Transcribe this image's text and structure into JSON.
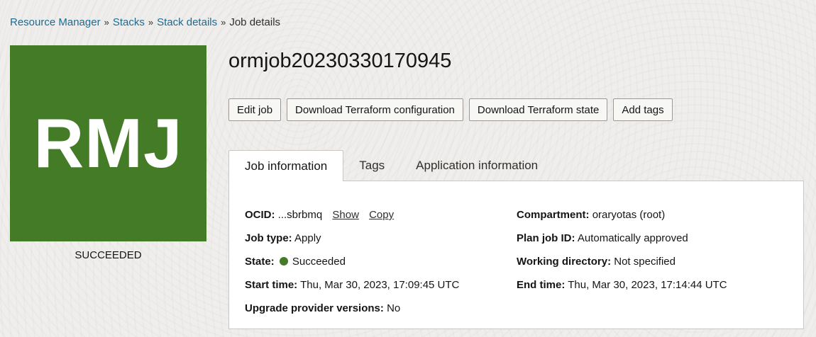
{
  "breadcrumb": {
    "items": [
      "Resource Manager",
      "Stacks",
      "Stack details"
    ],
    "current": "Job details",
    "separator": "»"
  },
  "tile": {
    "initials": "RMJ",
    "color": "#437b27"
  },
  "status": "SUCCEEDED",
  "title": "ormjob20230330170945",
  "toolbar": {
    "edit_job": "Edit job",
    "download_config": "Download Terraform configuration",
    "download_state": "Download Terraform state",
    "add_tags": "Add tags"
  },
  "tabs": [
    {
      "label": "Job information",
      "active": true
    },
    {
      "label": "Tags",
      "active": false
    },
    {
      "label": "Application information",
      "active": false
    }
  ],
  "info": {
    "ocid": {
      "label": "OCID:",
      "value": "...sbrbmq",
      "show": "Show",
      "copy": "Copy"
    },
    "job_type": {
      "label": "Job type:",
      "value": "Apply"
    },
    "state": {
      "label": "State:",
      "value": "Succeeded",
      "color": "#437b27"
    },
    "start_time": {
      "label": "Start time:",
      "value": "Thu, Mar 30, 2023, 17:09:45 UTC"
    },
    "upgrade": {
      "label": "Upgrade provider versions:",
      "value": "No"
    },
    "compartment": {
      "label": "Compartment:",
      "value": "oraryotas (root)"
    },
    "plan_job": {
      "label": "Plan job ID:",
      "value": "Automatically approved"
    },
    "working_dir": {
      "label": "Working directory:",
      "value": "Not specified"
    },
    "end_time": {
      "label": "End time:",
      "value": "Thu, Mar 30, 2023, 17:14:44 UTC"
    }
  }
}
